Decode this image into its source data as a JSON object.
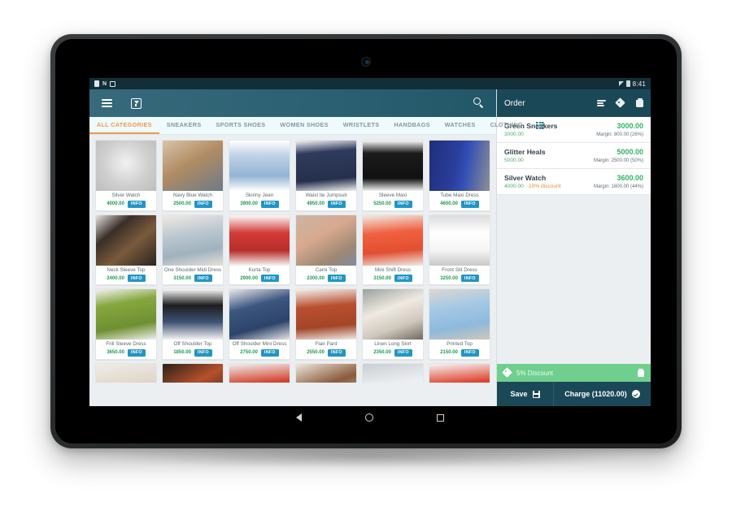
{
  "device": {
    "status_bar": {
      "time": "8:41",
      "left_icons": [
        "lock-icon",
        "n-icon",
        "square-icon"
      ],
      "right_icons": [
        "wifi-icon",
        "battery-icon"
      ]
    },
    "nav_bar": {
      "back": "back-icon",
      "home": "home-icon",
      "recents": "recents-icon"
    }
  },
  "appbar": {
    "menu_icon": "hamburger-icon",
    "inbox_icon": "inbox-download-icon",
    "search_icon": "search-icon"
  },
  "categories": {
    "items": [
      {
        "label": "ALL CATEGORIES",
        "active": true
      },
      {
        "label": "SNEAKERS",
        "active": false
      },
      {
        "label": "SPORTS SHOES",
        "active": false
      },
      {
        "label": "WOMEN SHOES",
        "active": false
      },
      {
        "label": "WRISTLETS",
        "active": false
      },
      {
        "label": "HANDBAGS",
        "active": false
      },
      {
        "label": "WATCHES",
        "active": false
      },
      {
        "label": "CLOTHING",
        "active": false
      }
    ],
    "grid_toggle_icon": "grid-view-icon",
    "active_color": "#f79548",
    "inactive_color": "#7b99a3"
  },
  "products": {
    "info_label": "INFO",
    "rows": [
      [
        {
          "name": "Silver Watch",
          "price": "4000.00"
        },
        {
          "name": "Navy Blue Watch",
          "price": "2500.00"
        },
        {
          "name": "Skinny Jean",
          "price": "3900.00"
        },
        {
          "name": "Waist tie Jumpsuit",
          "price": "4950.00"
        },
        {
          "name": "Sleeve Maxi",
          "price": "5250.00"
        },
        {
          "name": "Tube Maxi Dress",
          "price": "4600.00"
        }
      ],
      [
        {
          "name": "Neck Sleeve Top",
          "price": "2400.00"
        },
        {
          "name": "One Shoulder Midi Dress",
          "price": "3150.00"
        },
        {
          "name": "Kurta Top",
          "price": "2900.00"
        },
        {
          "name": "Cami Top",
          "price": "2300.00"
        },
        {
          "name": "Mini Shift Dress",
          "price": "3150.00"
        },
        {
          "name": "Front Slit Dress",
          "price": "3250.00"
        }
      ],
      [
        {
          "name": "Frill Sleeve Dress",
          "price": "3650.00"
        },
        {
          "name": "Off Shoulder Top",
          "price": "1850.00"
        },
        {
          "name": "Off Shoulder Mini Dress",
          "price": "2750.00"
        },
        {
          "name": "Flair Pant",
          "price": "2550.00"
        },
        {
          "name": "Linen Long Skirt",
          "price": "2350.00"
        },
        {
          "name": "Printed Top",
          "price": "2150.00"
        }
      ]
    ]
  },
  "order": {
    "title": "Order",
    "header_icons": [
      "list-lines-icon",
      "tag-icon",
      "trash-icon"
    ],
    "items": [
      {
        "name": "Green Sneakers",
        "total": "3000.00",
        "unit_price": "3000.00",
        "discount": "",
        "margin": "Margin: 800.00 (26%)"
      },
      {
        "name": "Glitter Heals",
        "total": "5000.00",
        "unit_price": "5000.00",
        "discount": "",
        "margin": "Margin: 2500.00 (50%)"
      },
      {
        "name": "Silver Watch",
        "total": "3600.00",
        "unit_price": "4000.00",
        "discount": "-10% discount",
        "margin": "Margin: 1600.00 (44%)"
      }
    ],
    "discount_bar": {
      "label": "5% Discount",
      "tag_icon": "tag-icon",
      "delete_icon": "trash-icon",
      "color": "#6fcf8f"
    },
    "actions": {
      "save_label": "Save",
      "save_icon": "save-disk-icon",
      "charge_label": "Charge (11020.00)",
      "charge_icon": "check-circle-icon"
    },
    "colors": {
      "header_bg": "#1b4857",
      "price_green": "#2eb563",
      "discount_orange": "#f08a3c"
    }
  }
}
